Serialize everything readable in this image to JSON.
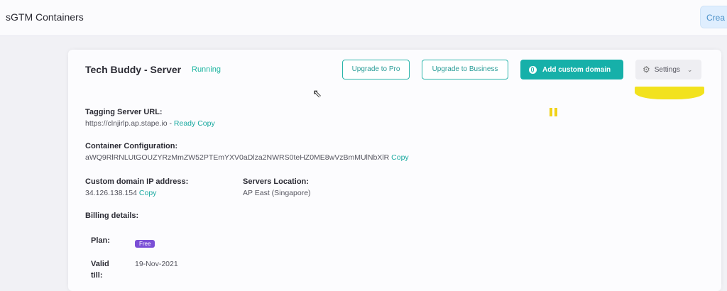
{
  "header": {
    "title": "sGTM Containers",
    "create_label": "Crea"
  },
  "card": {
    "server_name": "Tech Buddy - Server",
    "status": "Running",
    "buttons": {
      "upgrade_pro": "Upgrade to Pro",
      "upgrade_business": "Upgrade to Business",
      "add_domain": "Add custom domain",
      "settings": "Settings"
    },
    "tagging": {
      "label": "Tagging Server URL:",
      "url": "https://clnjirlp.ap.stape.io - ",
      "ready": "Ready",
      "copy": "Copy"
    },
    "config": {
      "label": "Container Configuration:",
      "value": "aWQ9RlRNLUtGOUZYRzMmZW52PTEmYXV0aDlza2NWRS0teHZ0ME8wVzBmMUlNbXlR",
      "copy": "Copy"
    },
    "ip": {
      "label": "Custom domain IP address:",
      "value": "34.126.138.154",
      "copy": "Copy"
    },
    "location": {
      "label": "Servers Location:",
      "value": "AP East (Singapore)"
    },
    "billing": {
      "label": "Billing details:",
      "plan_label": "Plan:",
      "plan_value": "Free",
      "valid_label_1": "Valid",
      "valid_label_2": "till:",
      "valid_value": "19-Nov-2021"
    }
  },
  "colors": {
    "accent": "#16b0a9",
    "status": "#1db5a0",
    "badge": "#7b4fd6",
    "highlight": "#f2e21e"
  }
}
